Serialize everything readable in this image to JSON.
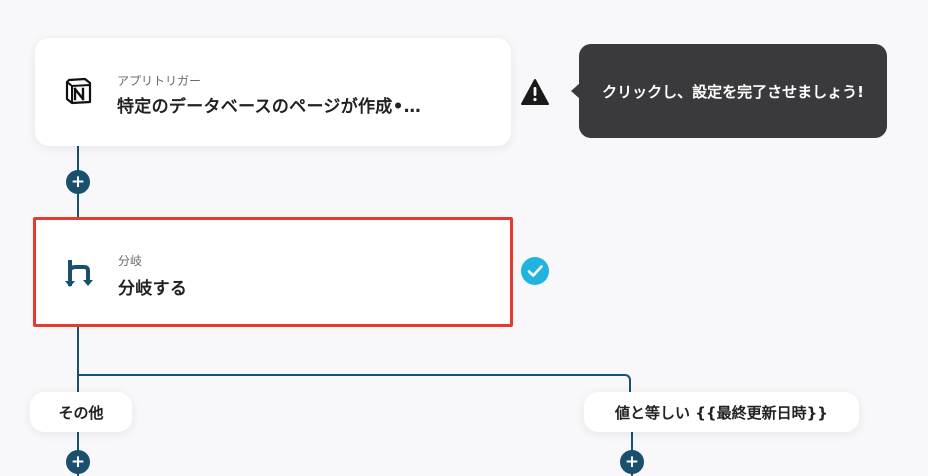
{
  "trigger": {
    "subtitle": "アプリトリガー",
    "title": "特定のデータベースのページが作成•…",
    "icon": "notion-logo-icon"
  },
  "warning": {
    "icon": "warning-icon",
    "tooltip": "クリックし、設定を完了させましょう!"
  },
  "branch": {
    "subtitle": "分岐",
    "title": "分岐する",
    "icon": "branch-icon",
    "status_icon": "check-icon",
    "highlight_color": "#e53a2c"
  },
  "branches": {
    "left_label": "その他",
    "right_label": "値と等しい {{最終更新日時}}"
  },
  "add_icon": "+",
  "colors": {
    "connector": "#1a4f6e",
    "check": "#20b3df",
    "tooltip_bg": "#3a3a3c"
  }
}
